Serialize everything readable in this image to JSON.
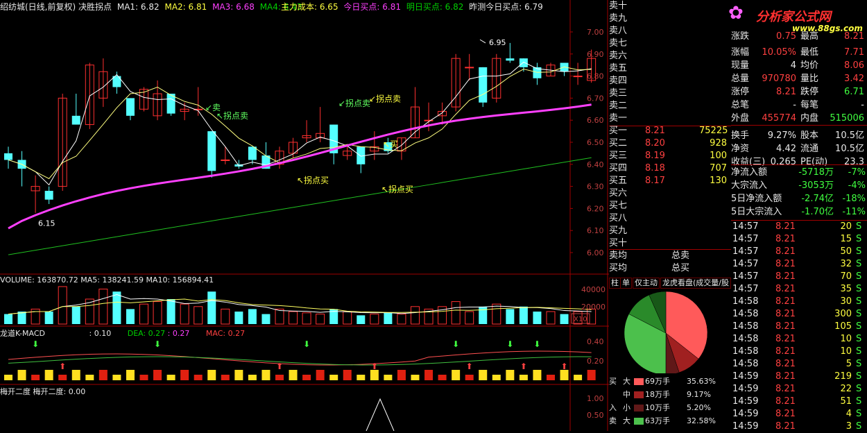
{
  "header": {
    "title": "绍纺城(日线,前复权)",
    "indicator": "决胜拐点",
    "ma1": "MA1: 6.82",
    "ma2": "MA2: 6.81",
    "ma3": "MA3: 6.68",
    "ma4": "MA4: 6.43",
    "cost": "主力成本: 6.65",
    "buy_today": "今日买点: 6.81",
    "buy_tomorrow": "明日买点: 6.82",
    "buy_yest": "昨测今日买点: 6.79"
  },
  "colors": {
    "up": "#ff3030",
    "down": "#54ffff",
    "ma1": "#ffffff",
    "ma2": "#ffff80",
    "ma3": "#ff40ff",
    "ma4": "#20c020",
    "axis": "#a00000"
  },
  "price_axis": [
    "7.00",
    "6.90",
    "6.80",
    "6.70",
    "6.60",
    "6.50",
    "6.40",
    "6.30",
    "6.20",
    "6.10",
    "6.00"
  ],
  "annotations": {
    "high": "6.95",
    "low": "6.15",
    "sell1": "卖",
    "sell2": "拐点卖",
    "sell3": "拐点卖",
    "sell4": "拐点卖",
    "buy1": "拐点买",
    "buy2": "拐点买",
    "buy3": "买"
  },
  "volume_panel": {
    "label": "VOLUME: 163870.72  MA5: 138241.59  MA10: 156894.41",
    "axis": [
      "40000",
      "20000"
    ],
    "unit": "X10"
  },
  "macd_panel": {
    "label": "龙道K-MACD",
    "diff": ": 0.10",
    "dea": "DEA: 0.27",
    "dea2": ": 0.27",
    "mac": "MAC: 0.27",
    "axis": [
      "0.40",
      "0.20"
    ]
  },
  "bottom_panel": {
    "label": "梅开二度  梅开二度: 0.00",
    "axis": [
      "1.00",
      "0.50"
    ]
  },
  "logo": {
    "name": "分析家公式网",
    "url": "www.88gs.com"
  },
  "chart_data": {
    "type": "candlestick",
    "candles": [
      [
        6.45,
        6.48,
        6.38,
        6.42
      ],
      [
        6.42,
        6.46,
        6.3,
        6.38
      ],
      [
        6.28,
        6.35,
        6.18,
        6.3
      ],
      [
        6.28,
        6.3,
        6.22,
        6.24
      ],
      [
        6.3,
        6.72,
        6.28,
        6.7
      ],
      [
        6.62,
        6.72,
        6.58,
        6.58
      ],
      [
        6.58,
        6.86,
        6.56,
        6.85
      ],
      [
        6.7,
        6.88,
        6.66,
        6.82
      ],
      [
        6.8,
        6.82,
        6.72,
        6.75
      ],
      [
        6.7,
        6.7,
        6.6,
        6.62
      ],
      [
        6.65,
        6.75,
        6.64,
        6.74
      ],
      [
        6.62,
        6.78,
        6.6,
        6.72
      ],
      [
        6.72,
        6.72,
        6.62,
        6.63
      ],
      [
        6.64,
        6.68,
        6.6,
        6.65
      ],
      [
        6.65,
        6.75,
        6.62,
        6.65
      ],
      [
        6.55,
        6.55,
        6.34,
        6.37
      ],
      [
        6.42,
        6.48,
        6.4,
        6.42
      ],
      [
        6.4,
        6.42,
        6.38,
        6.39
      ],
      [
        6.48,
        6.48,
        6.4,
        6.42
      ],
      [
        6.44,
        6.5,
        6.38,
        6.38
      ],
      [
        6.4,
        6.48,
        6.38,
        6.46
      ],
      [
        6.45,
        6.52,
        6.43,
        6.5
      ],
      [
        6.52,
        6.6,
        6.5,
        6.53
      ],
      [
        6.52,
        6.66,
        6.5,
        6.54
      ],
      [
        6.58,
        6.58,
        6.4,
        6.45
      ],
      [
        6.44,
        6.48,
        6.42,
        6.46
      ],
      [
        6.48,
        6.48,
        6.36,
        6.4
      ],
      [
        6.46,
        6.55,
        6.42,
        6.48
      ],
      [
        6.5,
        6.52,
        6.45,
        6.46
      ],
      [
        6.46,
        6.52,
        6.42,
        6.52
      ],
      [
        6.52,
        6.75,
        6.52,
        6.66
      ],
      [
        6.6,
        6.68,
        6.55,
        6.6
      ],
      [
        6.62,
        6.68,
        6.58,
        6.64
      ],
      [
        6.66,
        6.9,
        6.64,
        6.88
      ],
      [
        6.84,
        6.9,
        6.78,
        6.84
      ],
      [
        6.84,
        6.84,
        6.66,
        6.68
      ],
      [
        6.7,
        6.9,
        6.68,
        6.88
      ],
      [
        6.88,
        6.95,
        6.86,
        6.87
      ],
      [
        6.88,
        6.88,
        6.82,
        6.84
      ],
      [
        6.84,
        6.86,
        6.76,
        6.79
      ],
      [
        6.8,
        6.86,
        6.8,
        6.85
      ],
      [
        6.86,
        6.86,
        6.8,
        6.82
      ],
      [
        6.8,
        6.86,
        6.76,
        6.8
      ],
      [
        6.78,
        6.92,
        6.77,
        6.88
      ]
    ],
    "volume": [
      8,
      10,
      12,
      10,
      30,
      14,
      20,
      28,
      26,
      12,
      16,
      18,
      20,
      16,
      14,
      26,
      12,
      10,
      12,
      8,
      12,
      10,
      9,
      8,
      12,
      10,
      7,
      8,
      9,
      8,
      14,
      12,
      14,
      18,
      10,
      14,
      16,
      12,
      14,
      10,
      10,
      8,
      10,
      12
    ],
    "ylim": [
      5.95,
      7.05
    ]
  },
  "orderbook": {
    "sell_labels": [
      "卖十",
      "卖九",
      "卖八",
      "卖七",
      "卖六",
      "卖五",
      "卖四",
      "卖三",
      "卖二",
      "卖一"
    ],
    "buy_rows": [
      {
        "l": "买一",
        "p": "8.21",
        "v": "75225"
      },
      {
        "l": "买二",
        "p": "8.20",
        "v": "928"
      },
      {
        "l": "买三",
        "p": "8.19",
        "v": "100"
      },
      {
        "l": "买四",
        "p": "8.18",
        "v": "707"
      },
      {
        "l": "买五",
        "p": "8.17",
        "v": "130"
      }
    ],
    "buy_empty": [
      "买六",
      "买七",
      "买八",
      "买九",
      "买十"
    ],
    "avg_sell": "卖均",
    "total_sell": "总卖",
    "avg_buy": "买均",
    "total_buy": "总买",
    "tabs": [
      "柱",
      "单",
      "仅主动",
      "龙虎看盘(成交量/股"
    ]
  },
  "quote": [
    {
      "a": "涨跌",
      "av": "0.75",
      "b": "最高",
      "bv": "8.21"
    },
    {
      "a": "涨幅",
      "av": "10.05%",
      "b": "最低",
      "bv": "7.71"
    },
    {
      "a": "现量",
      "av": "4",
      "b": "均价",
      "bv": "8.06"
    },
    {
      "a": "总量",
      "av": "970780",
      "b": "量比",
      "bv": "3.42"
    },
    {
      "a": "涨停",
      "av": "8.21",
      "b": "跌停",
      "bv": "6.71"
    },
    {
      "a": "总笔",
      "av": "-",
      "b": "每笔",
      "bv": "-"
    },
    {
      "a": "外盘",
      "av": "455774",
      "b": "内盘",
      "bv": "515006"
    },
    {
      "a": "换手",
      "av": "9.27%",
      "b": "股本",
      "bv": "10.5亿"
    },
    {
      "a": "净资",
      "av": "4.42",
      "b": "流通",
      "bv": "10.5亿"
    },
    {
      "a": "收益(三)",
      "av": "0.265",
      "b": "PE(动)",
      "bv": "23.3"
    }
  ],
  "flow": [
    {
      "l": "净流入额",
      "v": "-5718万",
      "p": "-7%"
    },
    {
      "l": "大宗流入",
      "v": "-3053万",
      "p": "-4%"
    },
    {
      "l": "5日净流入额",
      "v": "-2.74亿",
      "p": "-18%"
    },
    {
      "l": "5日大宗流入",
      "v": "-1.70亿",
      "p": "-11%"
    }
  ],
  "pie_legend": [
    {
      "side": "买",
      "size": "大",
      "val": "69万手",
      "pct": "35.63%",
      "color": "#ff5a5a"
    },
    {
      "side": "",
      "size": "中",
      "val": "18万手",
      "pct": "9.17%",
      "color": "#a02020"
    },
    {
      "side": "入",
      "size": "小",
      "val": "10万手",
      "pct": "5.20%",
      "color": "#601818"
    },
    {
      "side": "卖",
      "size": "大",
      "val": "63万手",
      "pct": "32.58%",
      "color": "#4cc04c"
    }
  ],
  "pie_data": [
    35.63,
    9.17,
    5.2,
    32.58,
    10.8,
    6.6
  ],
  "ticks": [
    [
      "14:57",
      "8.21",
      "20",
      "S"
    ],
    [
      "14:57",
      "8.21",
      "15",
      "S"
    ],
    [
      "14:57",
      "8.21",
      "50",
      "S"
    ],
    [
      "14:57",
      "8.21",
      "32",
      "S"
    ],
    [
      "14:57",
      "8.21",
      "70",
      "S"
    ],
    [
      "14:57",
      "8.21",
      "35",
      "S"
    ],
    [
      "14:58",
      "8.21",
      "30",
      "S"
    ],
    [
      "14:58",
      "8.21",
      "300",
      "S"
    ],
    [
      "14:58",
      "8.21",
      "105",
      "S"
    ],
    [
      "14:58",
      "8.21",
      "10",
      "S"
    ],
    [
      "14:58",
      "8.21",
      "10",
      "S"
    ],
    [
      "14:58",
      "8.21",
      "5",
      "S"
    ],
    [
      "14:59",
      "8.21",
      "219",
      "S"
    ],
    [
      "14:59",
      "8.21",
      "22",
      "S"
    ],
    [
      "14:59",
      "8.21",
      "51",
      "S"
    ],
    [
      "14:59",
      "8.21",
      "4",
      "S"
    ],
    [
      "14:59",
      "8.21",
      "3",
      "S"
    ]
  ]
}
